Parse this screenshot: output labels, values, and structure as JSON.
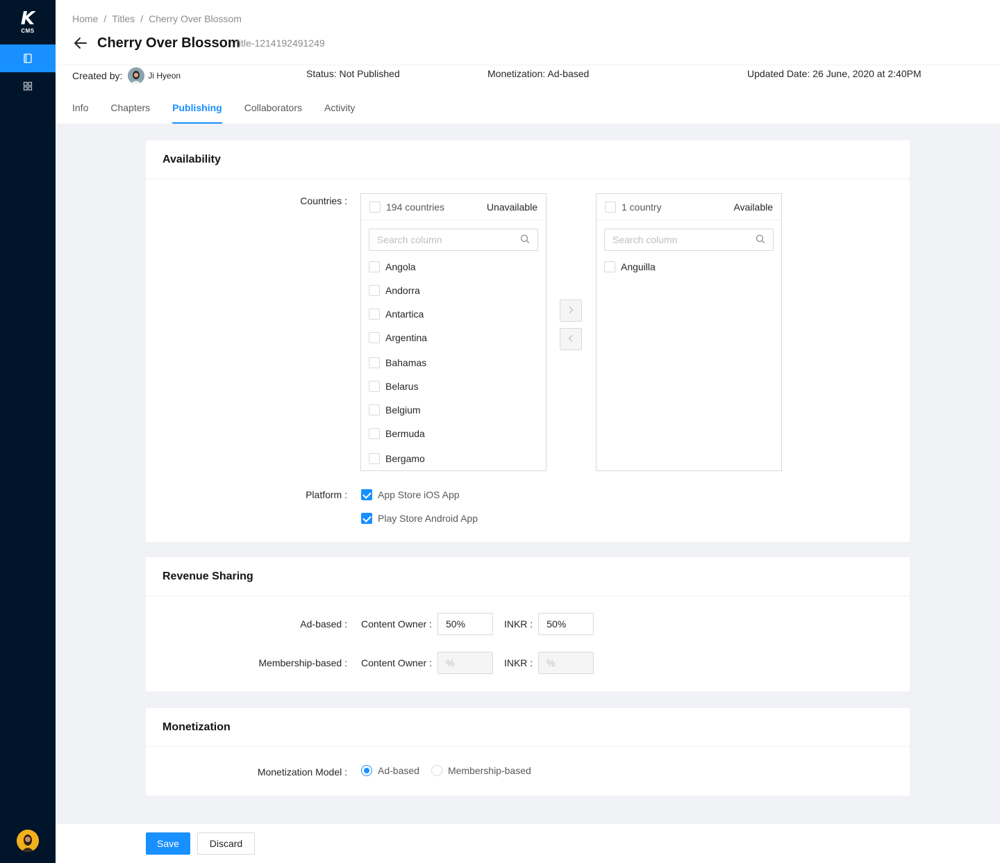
{
  "app": {
    "logo_letter": "K",
    "logo_sub": "CMS"
  },
  "sidebar": {
    "items": [
      {
        "icon": "book-icon",
        "active": true
      },
      {
        "icon": "apps-grid-icon",
        "active": false
      }
    ]
  },
  "breadcrumb": {
    "items": [
      "Home",
      "Titles",
      "Cherry Over Blossom"
    ],
    "separator": "/"
  },
  "header": {
    "title": "Cherry Over Blossom",
    "title_id": "title-1214192491249",
    "created_by_label": "Created by:",
    "creator_name": "Ji Hyeon",
    "status": "Status: Not Published",
    "monetization": "Monetization: Ad-based",
    "updated": "Updated Date: 26 June, 2020 at 2:40PM"
  },
  "tabs": [
    {
      "label": "Info",
      "active": false
    },
    {
      "label": "Chapters",
      "active": false
    },
    {
      "label": "Publishing",
      "active": true
    },
    {
      "label": "Collaborators",
      "active": false
    },
    {
      "label": "Activity",
      "active": false
    }
  ],
  "availability": {
    "title": "Availability",
    "countries_label": "Countries :",
    "left": {
      "count": "194 countries",
      "title": "Unavailable",
      "search_placeholder": "Search column",
      "items": [
        "Angola",
        "Andorra",
        "Antartica",
        "Argentina",
        "Bahamas",
        "Belarus",
        "Belgium",
        "Bermuda",
        "Bergamo"
      ]
    },
    "right": {
      "count": "1 country",
      "title": "Available",
      "search_placeholder": "Search column",
      "items": [
        "Anguilla"
      ]
    },
    "platform_label": "Platform :",
    "platforms": [
      {
        "label": "App Store iOS App",
        "checked": true
      },
      {
        "label": "Play Store Android App",
        "checked": true
      }
    ]
  },
  "revenue": {
    "title": "Revenue Sharing",
    "ad_label": "Ad-based :",
    "membership_label": "Membership-based :",
    "owner_label": "Content Owner :",
    "inkr_label": "INKR :",
    "ad_owner_value": "50%",
    "ad_inkr_value": "50%",
    "mem_owner_placeholder": "%",
    "mem_inkr_placeholder": "%"
  },
  "monetization": {
    "title": "Monetization",
    "model_label": "Monetization Model :",
    "options": [
      {
        "label": "Ad-based",
        "checked": true
      },
      {
        "label": "Membership-based",
        "checked": false
      }
    ]
  },
  "footer": {
    "save_label": "Save",
    "discard_label": "Discard"
  },
  "colors": {
    "primary": "#1890ff",
    "sidebar_bg": "#001529",
    "page_bg": "#f0f2f5"
  }
}
